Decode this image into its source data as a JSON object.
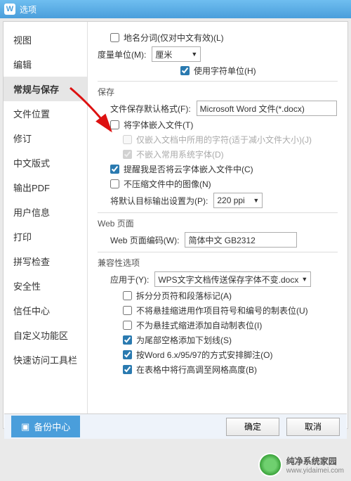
{
  "titlebar": {
    "logo": "W",
    "title": "选项"
  },
  "sidebar": {
    "items": [
      {
        "label": "视图"
      },
      {
        "label": "编辑"
      },
      {
        "label": "常规与保存"
      },
      {
        "label": "文件位置"
      },
      {
        "label": "修订"
      },
      {
        "label": "中文版式"
      },
      {
        "label": "输出PDF"
      },
      {
        "label": "用户信息"
      },
      {
        "label": "打印"
      },
      {
        "label": "拼写检查"
      },
      {
        "label": "安全性"
      },
      {
        "label": "信任中心"
      },
      {
        "label": "自定义功能区"
      },
      {
        "label": "快速访问工具栏"
      }
    ],
    "active_index": 2
  },
  "content": {
    "placename": "地名分词(仅对中文有效)(L)",
    "unit_label": "度量单位(M):",
    "unit_value": "厘米",
    "use_char_unit": "使用字符单位(H)",
    "save_section": "保存",
    "file_fmt_label": "文件保存默认格式(F):",
    "file_fmt_value": "Microsoft Word 文件(*.docx)",
    "embed_font": "将字体嵌入文件(T)",
    "embed_only_used": "仅嵌入文档中所用的字符(适于减小文件大小)(J)",
    "no_common_font": "不嵌入常用系统字体(D)",
    "cloud_font": "提醒我是否将云字体嵌入文件中(C)",
    "no_compress_img": "不压缩文件中的图像(N)",
    "default_output_label": "将默认目标输出设置为(P):",
    "default_output_value": "220 ppi",
    "web_section": "Web 页面",
    "web_encoding_label": "Web 页面编码(W):",
    "web_encoding_value": "简体中文 GB2312",
    "compat_section": "兼容性选项",
    "apply_label": "应用于(Y):",
    "apply_value": "WPS文字文档传送保存字体不变.docx",
    "opt_split_page": "拆分分页符和段落标记(A)",
    "opt_no_hang_tab": "不将悬挂缩进用作项目符号和编号的制表位(U)",
    "opt_no_auto_tab": "不为悬挂式缩进添加自动制表位(I)",
    "opt_trailing_underline": "为尾部空格添加下划线(S)",
    "opt_word6_footnote": "按Word 6.x/95/97的方式安排脚注(O)",
    "opt_table_row_height": "在表格中将行高调至网格高度(B)"
  },
  "footer": {
    "backup": "备份中心",
    "ok": "确定",
    "cancel": "取消"
  },
  "watermark": {
    "brand": "纯净系统家园",
    "url": "www.yidaimei.com"
  }
}
